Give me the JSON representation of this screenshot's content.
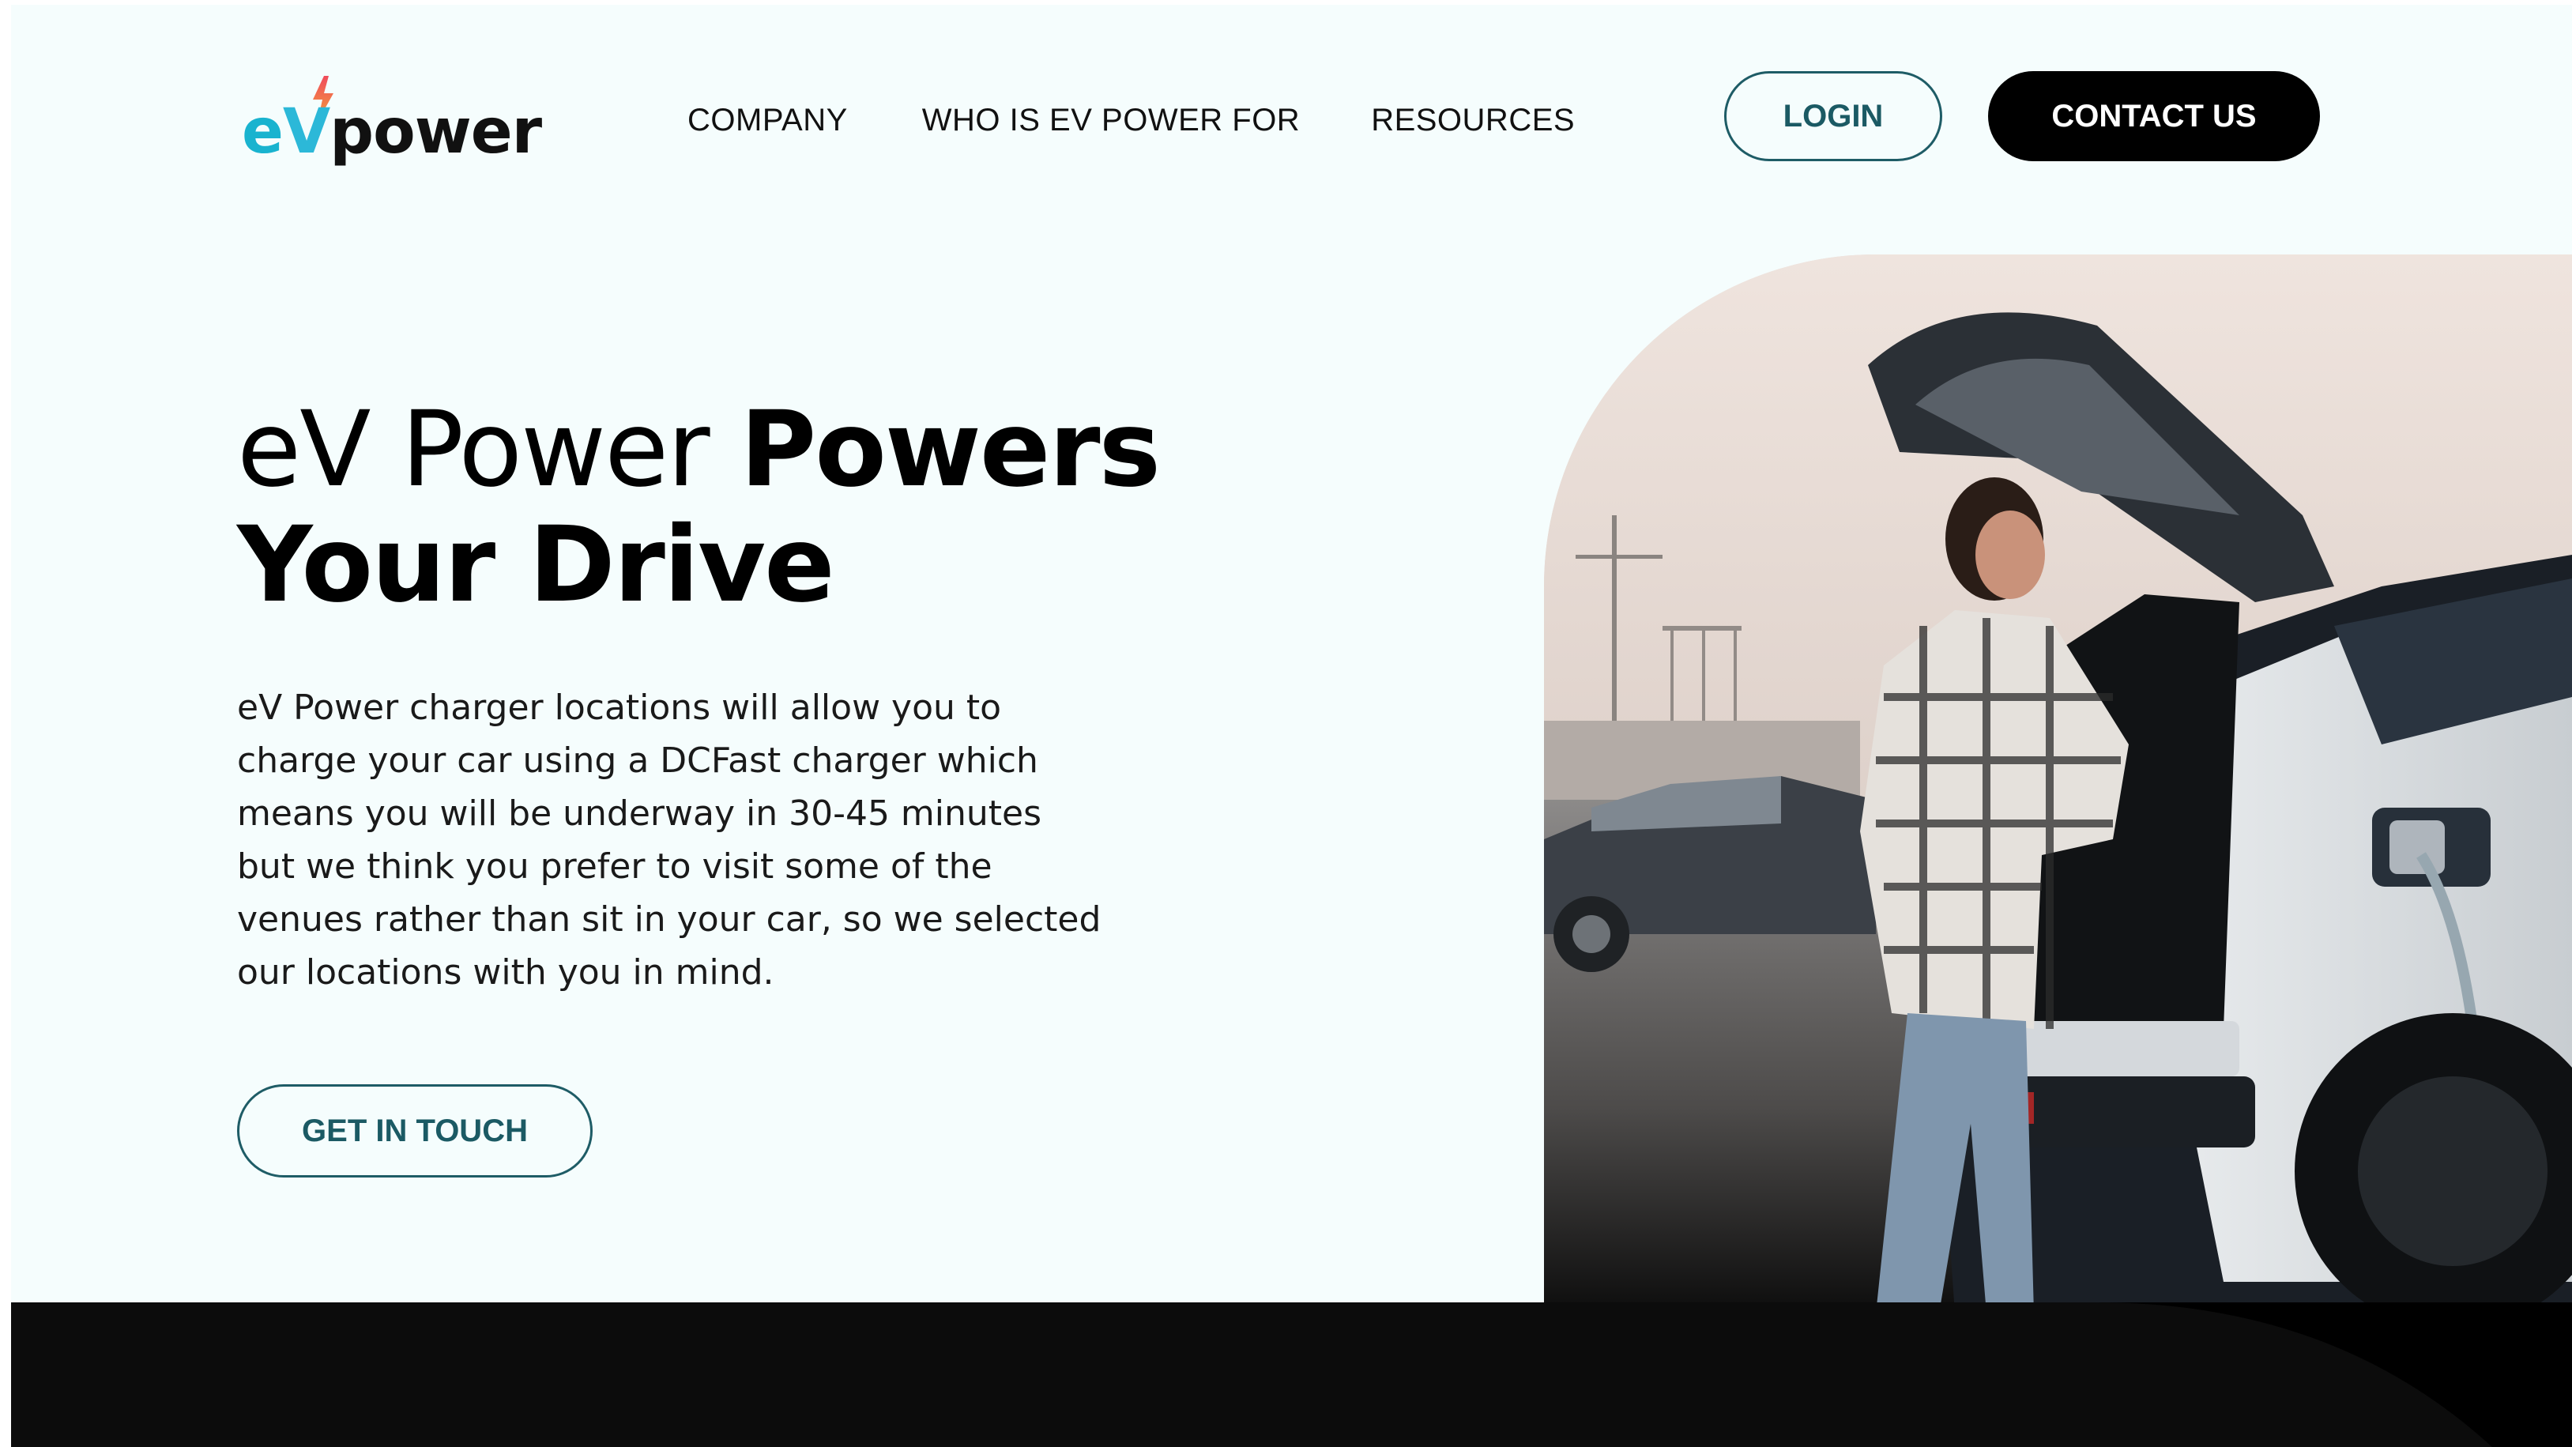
{
  "logo": {
    "part_e": "e",
    "part_v": "V",
    "part_power": "power",
    "bolt_icon": "lightning-bolt-icon",
    "colors": {
      "e": "#19b3cf",
      "v": "#2cb8d8",
      "power": "#111111",
      "bolt_top": "#f04b5c",
      "bolt_bottom": "#f3a23a"
    }
  },
  "nav": {
    "items": [
      {
        "label": "COMPANY"
      },
      {
        "label": "WHO IS EV POWER FOR"
      },
      {
        "label": "RESOURCES"
      }
    ]
  },
  "header_actions": {
    "login_label": "LOGIN",
    "contact_label": "CONTACT US"
  },
  "hero": {
    "title_light": "eV Power ",
    "title_bold_1": "Powers",
    "title_bold_2": "Your Drive",
    "description": "eV Power charger locations will allow you to\ncharge your car using a DCFast charger which\nmeans you will be underway in 30-45 minutes\nbut we think you prefer to visit some of the\nvenues  rather than sit in your car, so we selected\nour locations with you in mind.",
    "cta_label": "GET IN TOUCH",
    "image_subject": "woman-loading-trunk-of-charging-electric-car-photo"
  },
  "colors": {
    "page_background": "#f5fdfd",
    "accent_teal": "#1b5a64",
    "dark_band": "#0c0c0c",
    "contact_button": "#000000"
  }
}
